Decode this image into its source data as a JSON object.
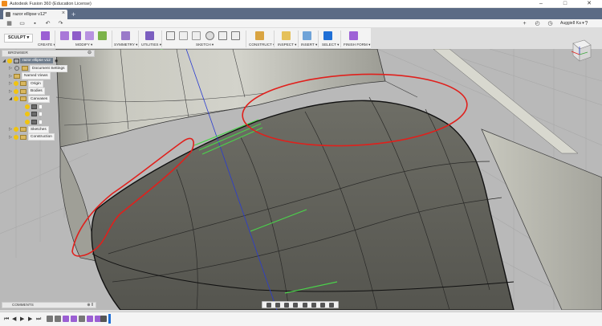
{
  "window": {
    "title": "Autodesk Fusion 360 (Education License)",
    "minimize": "–",
    "maximize": "□",
    "close": "✕"
  },
  "tabs": [
    {
      "label": "razor ellipse v12*",
      "close": "×"
    }
  ],
  "tab_add": "+",
  "quick": {
    "user": "Auggie8 Ka ▾"
  },
  "ribbon": {
    "workspace": "SCULPT ▾",
    "groups": [
      {
        "label": "CREATE ▾"
      },
      {
        "label": "MODIFY ▾"
      },
      {
        "label": "SYMMETRY ▾"
      },
      {
        "label": "UTILITIES ▾"
      },
      {
        "label": "SKETCH ▾"
      },
      {
        "label": "CONSTRUCT ▾"
      },
      {
        "label": "INSPECT ▾"
      },
      {
        "label": "INSERT ▾"
      },
      {
        "label": "SELECT ▾"
      },
      {
        "label": "FINISH FORM ▾"
      }
    ]
  },
  "browser": {
    "title": "BROWSER",
    "root": "razor ellipse v12",
    "items": [
      {
        "label": "Document Settings"
      },
      {
        "label": "Named Views"
      },
      {
        "label": "Origin"
      },
      {
        "label": "Bodies"
      },
      {
        "label": "Canvases"
      },
      {
        "label": "Sketches"
      },
      {
        "label": "Construction"
      }
    ]
  },
  "comments": {
    "label": "COMMENTS"
  },
  "colors": {
    "accent": "#1f6fd6",
    "selection_outline": "#e0201c",
    "surface": "#5d5d55",
    "grid": "#a8a8a8"
  },
  "icons": [
    "app-logo-icon",
    "home-icon",
    "save-icon",
    "undo-icon",
    "redo-icon",
    "folder-icon",
    "bulb-icon",
    "viewcube-icon"
  ]
}
